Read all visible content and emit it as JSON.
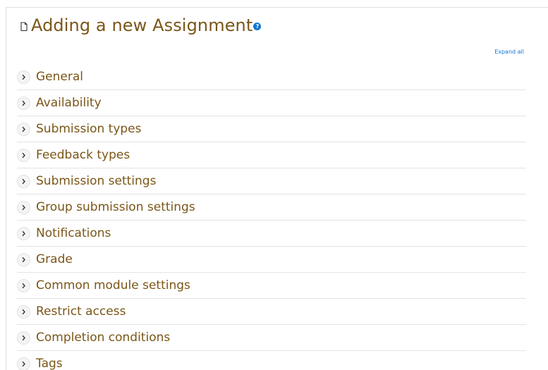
{
  "header": {
    "title": "Adding a new Assignment",
    "help_glyph": "?"
  },
  "toolbar": {
    "expand_all_label": "Expand all"
  },
  "sections": [
    {
      "label": "General"
    },
    {
      "label": "Availability"
    },
    {
      "label": "Submission types"
    },
    {
      "label": "Feedback types"
    },
    {
      "label": "Submission settings"
    },
    {
      "label": "Group submission settings"
    },
    {
      "label": "Notifications"
    },
    {
      "label": "Grade"
    },
    {
      "label": "Common module settings"
    },
    {
      "label": "Restrict access"
    },
    {
      "label": "Completion conditions"
    },
    {
      "label": "Tags"
    }
  ],
  "colors": {
    "heading": "#7a5617",
    "link": "#1177d1",
    "divider": "#e3e3e3"
  },
  "icons": {
    "title_icon": "document-icon",
    "help_icon": "help-icon",
    "section_icon": "chevron-right-icon"
  }
}
